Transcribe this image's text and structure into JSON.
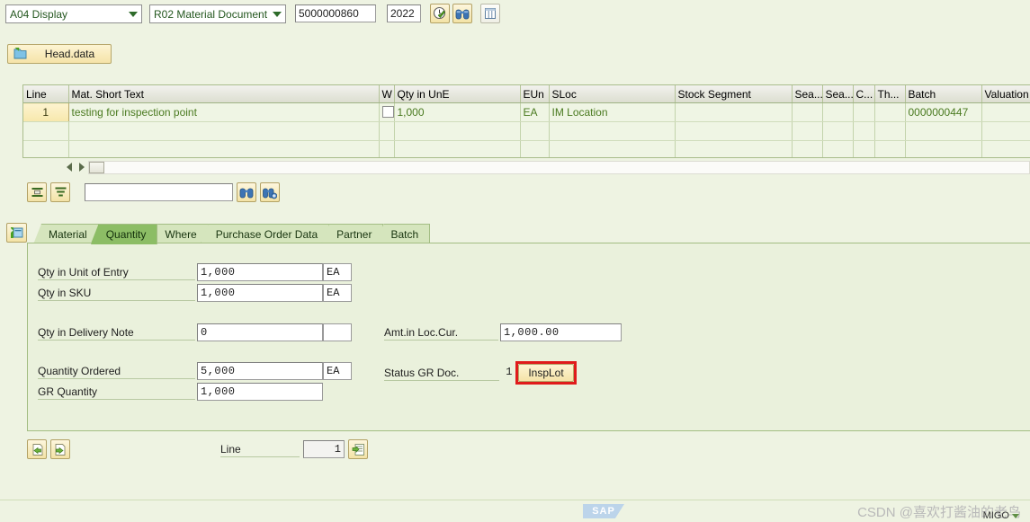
{
  "toolbar": {
    "action_mode": "A04 Display",
    "doc_category": "R02 Material Document",
    "document_number": "5000000860",
    "year": "2022",
    "execute_label": "execute-icon",
    "find_label": "find-icon",
    "detail_label": "detail-list-icon"
  },
  "headdata": {
    "label": "Head.data"
  },
  "grid": {
    "columns": [
      {
        "key": "line",
        "label": "Line"
      },
      {
        "key": "text",
        "label": "Mat. Short Text"
      },
      {
        "key": "w",
        "label": "W"
      },
      {
        "key": "qty",
        "label": "Qty in UnE"
      },
      {
        "key": "eun",
        "label": "EUn"
      },
      {
        "key": "sloc",
        "label": "SLoc"
      },
      {
        "key": "stockseg",
        "label": "Stock Segment"
      },
      {
        "key": "sea1",
        "label": "Sea..."
      },
      {
        "key": "sea2",
        "label": "Sea..."
      },
      {
        "key": "c",
        "label": "C..."
      },
      {
        "key": "th",
        "label": "Th..."
      },
      {
        "key": "batch",
        "label": "Batch"
      },
      {
        "key": "valtype",
        "label": "Valuation Ty..."
      }
    ],
    "rows": [
      {
        "line": "1",
        "text": "testing for inspection point",
        "w": "",
        "qty": "1,000",
        "eun": "EA",
        "sloc": "IM Location",
        "stockseg": "",
        "sea1": "",
        "sea2": "",
        "c": "",
        "th": "",
        "batch": "0000000447",
        "valtype": ""
      }
    ],
    "empty_row_count": 2
  },
  "findbar": {
    "search_value": "",
    "search_placeholder": ""
  },
  "tabs": [
    {
      "label": "Material",
      "active": false
    },
    {
      "label": "Quantity",
      "active": true
    },
    {
      "label": "Where",
      "active": false
    },
    {
      "label": "Purchase Order Data",
      "active": false
    },
    {
      "label": "Partner",
      "active": false
    },
    {
      "label": "Batch",
      "active": false
    }
  ],
  "form": {
    "qty_unit_entry_label": "Qty in Unit of Entry",
    "qty_unit_entry_value": "1,000",
    "qty_unit_entry_uom": "EA",
    "qty_sku_label": "Qty in SKU",
    "qty_sku_value": "1,000",
    "qty_sku_uom": "EA",
    "qty_delivery_note_label": "Qty in Delivery Note",
    "qty_delivery_note_value": "0",
    "qty_delivery_note_uom": "",
    "amt_loc_cur_label": "Amt.in Loc.Cur.",
    "amt_loc_cur_value": "1,000.00",
    "quantity_ordered_label": "Quantity Ordered",
    "quantity_ordered_value": "5,000",
    "quantity_ordered_uom": "EA",
    "status_gr_doc_label": "Status GR Doc.",
    "status_gr_doc_value": "1",
    "insplot_label": "InspLot",
    "gr_quantity_label": "GR Quantity",
    "gr_quantity_value": "1,000"
  },
  "footer": {
    "line_label": "Line",
    "line_value": "1"
  },
  "statusbar": {
    "logo": "SAP",
    "watermark": "CSDN @喜欢打酱油的老鸟",
    "transaction_code": "MIGO"
  },
  "colors": {
    "background": "#eef3e2",
    "tab_active": "#8cbd65",
    "grid_text": "#4a7a20",
    "focus_red": "#e01b1b",
    "button_yellow": "#f5e3a8"
  }
}
